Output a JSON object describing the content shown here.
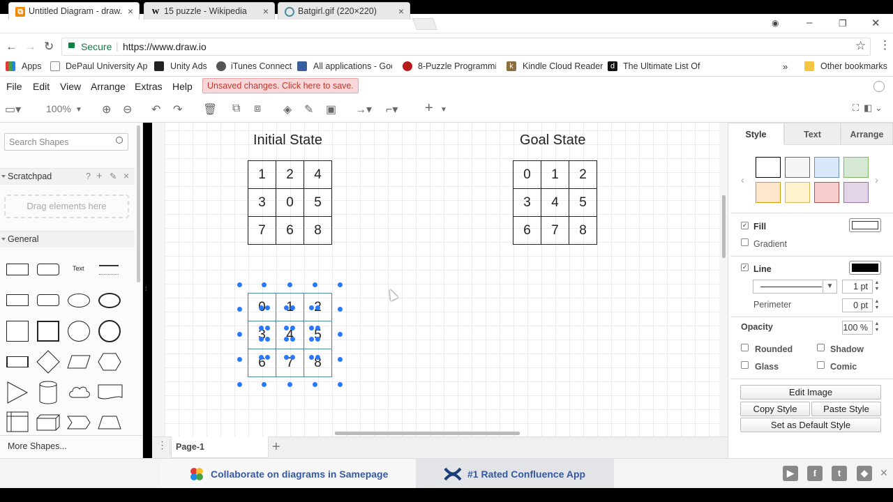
{
  "browser": {
    "tabs": [
      {
        "title": "Untitled Diagram - draw.",
        "icon": "drawio-icon",
        "active": true
      },
      {
        "title": "15 puzzle - Wikipedia",
        "icon": "wikipedia-icon",
        "active": false
      },
      {
        "title": "Batgirl.gif (220×220)",
        "icon": "image-icon",
        "active": false
      }
    ],
    "secure_label": "Secure",
    "url": "https://www.draw.io",
    "bookmarks": [
      "Apps",
      "DePaul University Ap",
      "Unity Ads",
      "iTunes Connect",
      "All applications - Goo",
      "8-Puzzle Programmin",
      "Kindle Cloud Reader",
      "The Ultimate List Of",
      "Other bookmarks"
    ]
  },
  "menu": {
    "items": [
      "File",
      "Edit",
      "View",
      "Arrange",
      "Extras",
      "Help"
    ],
    "unsaved": "Unsaved changes. Click here to save."
  },
  "toolbar": {
    "zoom": "100%"
  },
  "sidebar": {
    "search_placeholder": "Search Shapes",
    "scratchpad": "Scratchpad",
    "scratchpad_help": "?",
    "drag_here": "Drag elements here",
    "general": "General",
    "text_shape": "Text",
    "more_shapes": "More Shapes..."
  },
  "canvas": {
    "initial_title": "Initial State",
    "goal_title": "Goal State",
    "initial_grid": [
      [
        "1",
        "2",
        "4"
      ],
      [
        "3",
        "0",
        "5"
      ],
      [
        "7",
        "6",
        "8"
      ]
    ],
    "goal_grid": [
      [
        "0",
        "1",
        "2"
      ],
      [
        "3",
        "4",
        "5"
      ],
      [
        "6",
        "7",
        "8"
      ]
    ],
    "selected_grid": [
      [
        "0",
        "1",
        "2"
      ],
      [
        "3",
        "4",
        "5"
      ],
      [
        "6",
        "7",
        "8"
      ]
    ]
  },
  "pages": {
    "current": "Page-1"
  },
  "panel": {
    "tabs": [
      "Style",
      "Text",
      "Arrange"
    ],
    "swatches": [
      {
        "fill": "#ffffff",
        "border": "#000000"
      },
      {
        "fill": "#f5f5f5",
        "border": "#666666"
      },
      {
        "fill": "#dae8fc",
        "border": "#6c8ebf"
      },
      {
        "fill": "#d5e8d4",
        "border": "#82b366"
      },
      {
        "fill": "#ffe6cc",
        "border": "#d79b00"
      },
      {
        "fill": "#fff2cc",
        "border": "#d6b656"
      },
      {
        "fill": "#f8cecc",
        "border": "#b85450"
      },
      {
        "fill": "#e1d5e7",
        "border": "#9673a6"
      }
    ],
    "fill_label": "Fill",
    "gradient_label": "Gradient",
    "line_label": "Line",
    "line_width": "1 pt",
    "perimeter_label": "Perimeter",
    "perimeter_value": "0 pt",
    "opacity_label": "Opacity",
    "opacity_value": "100 %",
    "rounded": "Rounded",
    "shadow": "Shadow",
    "glass": "Glass",
    "comic": "Comic",
    "edit_image": "Edit Image",
    "copy_style": "Copy Style",
    "paste_style": "Paste Style",
    "default_style": "Set as Default Style"
  },
  "footer": {
    "ad1": "Collaborate on diagrams in Samepage",
    "ad2": "#1 Rated Confluence App"
  }
}
